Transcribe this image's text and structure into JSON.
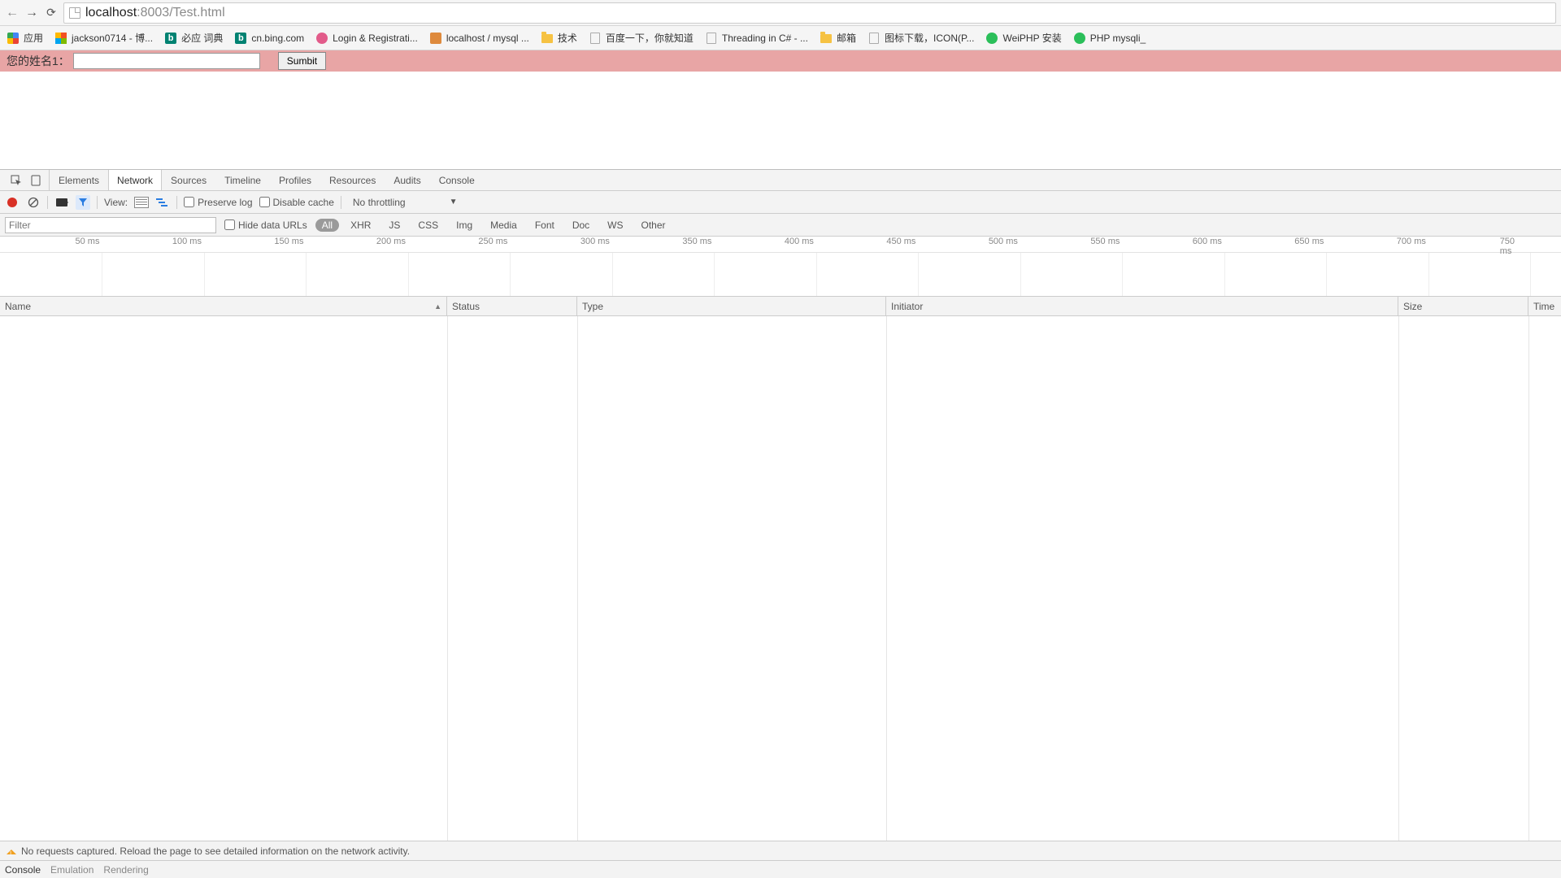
{
  "nav": {
    "url_domain": "localhost",
    "url_rest": ":8003/Test.html"
  },
  "bookmarks": [
    {
      "icon": "apps",
      "label": "应用"
    },
    {
      "icon": "ms",
      "label": "jackson0714 - 博..."
    },
    {
      "icon": "b-blue",
      "label": "必应 词典"
    },
    {
      "icon": "b-blue",
      "label": "cn.bing.com"
    },
    {
      "icon": "pink",
      "label": "Login & Registrati..."
    },
    {
      "icon": "orange",
      "label": "localhost / mysql ..."
    },
    {
      "icon": "folder",
      "label": "技术"
    },
    {
      "icon": "doc",
      "label": "百度一下，你就知道"
    },
    {
      "icon": "doc",
      "label": "Threading in C# - ..."
    },
    {
      "icon": "folder",
      "label": "邮箱"
    },
    {
      "icon": "doc",
      "label": "图标下载，ICON(P..."
    },
    {
      "icon": "green",
      "label": "WeiPHP 安装"
    },
    {
      "icon": "green",
      "label": "PHP mysqli_"
    }
  ],
  "page": {
    "form_label": "您的姓名1：",
    "submit_label": "Sumbit"
  },
  "devtools": {
    "tabs": [
      "Elements",
      "Network",
      "Sources",
      "Timeline",
      "Profiles",
      "Resources",
      "Audits",
      "Console"
    ],
    "active_tab": "Network",
    "toolbar": {
      "view_label": "View:",
      "preserve_log": "Preserve log",
      "disable_cache": "Disable cache",
      "throttling": "No throttling"
    },
    "filter": {
      "placeholder": "Filter",
      "hide_urls": "Hide data URLs",
      "types": [
        "All",
        "XHR",
        "JS",
        "CSS",
        "Img",
        "Media",
        "Font",
        "Doc",
        "WS",
        "Other"
      ],
      "active_type": "All"
    },
    "timeline_ticks": [
      "50 ms",
      "100 ms",
      "150 ms",
      "200 ms",
      "250 ms",
      "300 ms",
      "350 ms",
      "400 ms",
      "450 ms",
      "500 ms",
      "550 ms",
      "600 ms",
      "650 ms",
      "700 ms",
      "750 ms"
    ],
    "columns": [
      "Name",
      "Status",
      "Type",
      "Initiator",
      "Size",
      "Time"
    ],
    "status_message": "No requests captured. Reload the page to see detailed information on the network activity.",
    "drawer_tabs": [
      "Console",
      "Emulation",
      "Rendering"
    ]
  }
}
